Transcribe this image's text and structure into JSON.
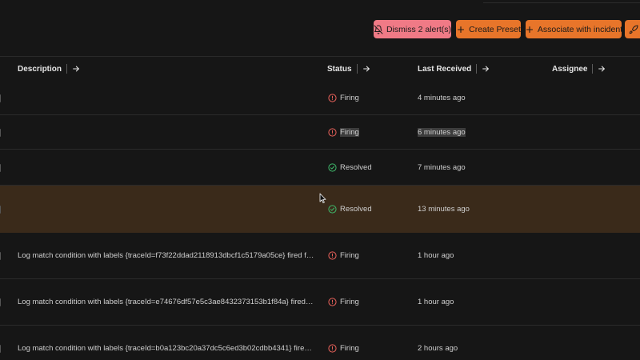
{
  "toolbar": {
    "dismiss_label": "Dismiss 2 alert(s)",
    "create_preset_label": "Create Preset",
    "associate_label": "Associate with incident",
    "colors": {
      "dismiss": "#f07a86",
      "action": "#e8752a"
    }
  },
  "table": {
    "columns": [
      {
        "label": "Description"
      },
      {
        "label": "Status"
      },
      {
        "label": "Last Received"
      },
      {
        "label": "Assignee"
      }
    ],
    "rows": [
      {
        "description": "",
        "status": "Firing",
        "status_icon": "alert-circle-icon",
        "last_received": "4 minutes ago",
        "selected": false
      },
      {
        "description": "",
        "status": "Firing",
        "status_icon": "alert-circle-icon",
        "last_received": "6 minutes ago",
        "selected": true
      },
      {
        "description": "",
        "status": "Resolved",
        "status_icon": "check-circle-icon",
        "last_received": "7 minutes ago",
        "selected": false
      },
      {
        "description": "",
        "status": "Resolved",
        "status_icon": "check-circle-icon",
        "last_received": "13 minutes ago",
        "selected": false,
        "highlighted": true
      },
      {
        "description": "Log match condition with labels {traceId=f73f22ddad2118913dbcf1c5179a05ce} fired for…",
        "status": "Firing",
        "status_icon": "alert-circle-icon",
        "last_received": "1 hour ago",
        "selected": false
      },
      {
        "description": "Log match condition with labels {traceId=e74676df57e5c3ae8432373153b1f84a} fired fo…",
        "status": "Firing",
        "status_icon": "alert-circle-icon",
        "last_received": "1 hour ago",
        "selected": false
      },
      {
        "description": "Log match condition with labels {traceId=b0a123bc20a37dc5c6ed3b02cdbb4341} fired f…",
        "status": "Firing",
        "status_icon": "alert-circle-icon",
        "last_received": "2 hours ago",
        "selected": false
      }
    ]
  },
  "status_colors": {
    "firing": "#e8615a",
    "resolved": "#3fb86a"
  }
}
